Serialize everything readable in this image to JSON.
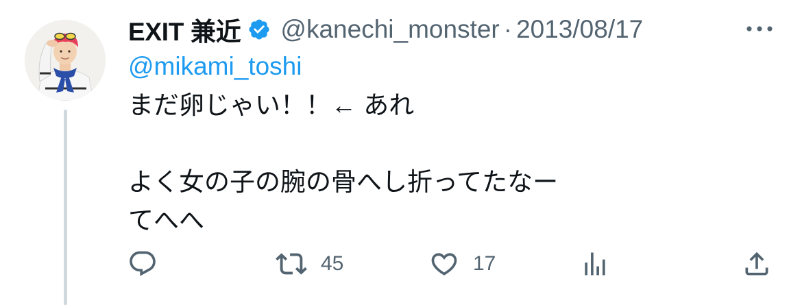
{
  "tweet": {
    "author": {
      "display_name": "EXIT 兼近",
      "handle": "@kanechi_monster",
      "verified": true,
      "avatar_icon": "profile-photo"
    },
    "separator": "·",
    "date": "2013/08/17",
    "replying_to": "@mikami_toshi",
    "text_lines": [
      "まだ卵じゃい！！← あれ",
      "",
      "よく女の子の腕の骨へし折ってたなー",
      "てへへ"
    ],
    "actions": {
      "reply": {
        "icon": "reply-icon",
        "count": ""
      },
      "retweet": {
        "icon": "retweet-icon",
        "count": "45"
      },
      "like": {
        "icon": "heart-icon",
        "count": "17"
      },
      "views": {
        "icon": "analytics-icon",
        "count": ""
      },
      "share": {
        "icon": "share-icon",
        "count": ""
      }
    },
    "more_icon": "more-icon"
  },
  "colors": {
    "text": "#0f1419",
    "secondary": "#536471",
    "link": "#1d9bf0",
    "verified": "#1d9bf0",
    "thread_line": "#cfd9de",
    "avatar_hair": "#e8405a",
    "avatar_scarf": "#2b4fa8"
  }
}
